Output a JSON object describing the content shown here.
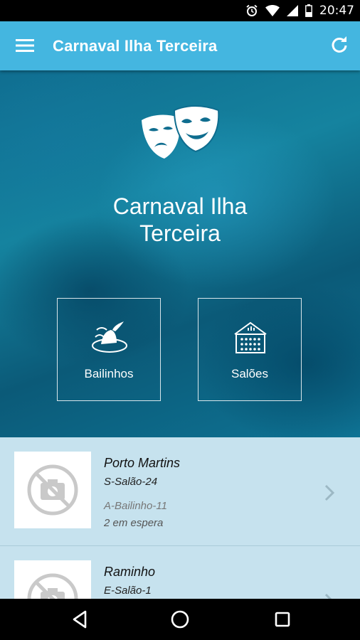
{
  "status_bar": {
    "time": "20:47",
    "icons": [
      "alarm-icon",
      "wifi-icon",
      "signal-icon",
      "battery-icon"
    ]
  },
  "app_bar": {
    "title": "Carnaval Ilha Terceira",
    "menu_icon": "hamburger-menu-icon",
    "refresh_icon": "refresh-icon",
    "color": "#44b6e0"
  },
  "hero": {
    "title_line1": "Carnaval Ilha",
    "title_line2": "Terceira",
    "icon": "theater-masks-icon",
    "tiles": [
      {
        "label": "Bailinhos",
        "icon": "dancer-hat-icon"
      },
      {
        "label": "Salões",
        "icon": "audience-hall-icon"
      }
    ]
  },
  "list": {
    "items": [
      {
        "title": "Porto Martins",
        "subtitle": "S-Salão-24",
        "meta1": "A-Bailinho-11",
        "meta2": "2 em espera",
        "thumbnail_icon": "no-photo-icon"
      },
      {
        "title": "Raminho",
        "subtitle": "E-Salão-1",
        "meta1": "",
        "meta2": "",
        "thumbnail_icon": "no-photo-icon"
      }
    ],
    "background": "#c6e2ee"
  },
  "nav_bar": {
    "buttons": [
      "back-icon",
      "home-icon",
      "recents-icon"
    ]
  }
}
